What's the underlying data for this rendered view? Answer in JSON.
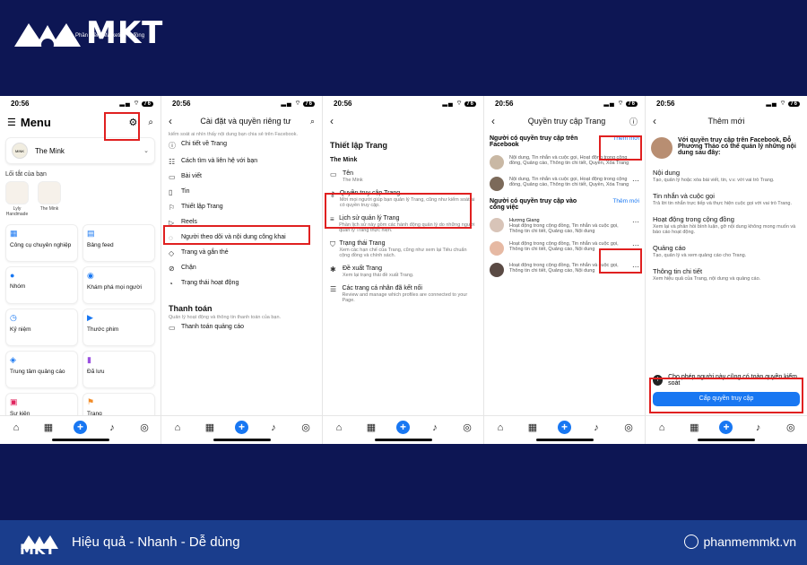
{
  "brand": {
    "name": "MKT",
    "sub": "Phần mềm Marketing 0 đồng"
  },
  "footer": {
    "tagline": "Hiệu quả - Nhanh  - Dễ dùng",
    "site": "phanmemmkt.vn"
  },
  "status_time": "20:56",
  "battery": "76",
  "phone1": {
    "title": "Menu",
    "profile": "The Mink",
    "shortcuts_label": "Lối tắt của bạn",
    "shortcuts": [
      "Lyly Handmade",
      "The Mink"
    ],
    "left": [
      "Công cụ chuyên nghiệp",
      "Nhóm",
      "Kỷ niệm",
      "Trung tâm quảng cáo",
      "Sự kiện"
    ],
    "right": [
      "Bảng feed",
      "Khám phá mọi người",
      "Thước phim",
      "Đã lưu",
      "Trang"
    ]
  },
  "phone2": {
    "title": "Cài đặt và quyền riêng tư",
    "note": "kiểm soát ai nhìn thấy nội dung bạn chia sẻ trên Facebook.",
    "items": [
      "Chi tiết về Trang",
      "Cách tìm và liên hệ với bạn",
      "Bài viết",
      "Tin",
      "Thiết lập Trang",
      "Reels",
      "Người theo dõi và nội dung công khai",
      "Trang và gắn thẻ",
      "Chặn",
      "Trạng thái hoạt động"
    ],
    "section": "Thanh toán",
    "section_note": "Quản lý hoạt động và thông tin thanh toán của bạn.",
    "section_item": "Thanh toán quảng cáo"
  },
  "phone3": {
    "title": "Thiết lập Trang",
    "page": "The Mink",
    "items": [
      {
        "t": "Tên",
        "d": "The Mink"
      },
      {
        "t": "Quyền truy cập Trang",
        "d": "Mời mọi người giúp bạn quản lý Trang, cũng như kiểm soát ai có quyền truy cập."
      },
      {
        "t": "Lịch sử quản lý Trang",
        "d": "Phần lịch sử này gồm các hành động quản lý do những người quản lý Trang thực hiện."
      },
      {
        "t": "Trạng thái Trang",
        "d": "Xem các hạn chế của Trang, cũng như xem lại Tiêu chuẩn cộng đồng và chính sách."
      },
      {
        "t": "Đề xuất Trang",
        "d": "Xem lại trạng thái đề xuất Trang."
      },
      {
        "t": "Các trang cá nhân đã kết nối",
        "d": "Review and manage which profiles are connected to your Page."
      }
    ]
  },
  "phone4": {
    "title": "Quyền truy cập Trang",
    "fb_section": "Người có quyền truy cập trên Facebook",
    "add": "Thêm mới",
    "fb_people": [
      "Nội dung, Tin nhắn và cuộc gọi, Hoạt động trong cộng đồng, Quảng cáo, Thông tin chi tiết, Quyền, Xóa Trang",
      "Nội dung, Tin nhắn và cuộc gọi, Hoạt động trong cộng đồng, Quảng cáo, Thông tin chi tiết, Quyền, Xóa Trang"
    ],
    "task_section": "Người có quyền truy cập vào công việc",
    "task_people": [
      "Hương Giang",
      "Hoạt động trong cộng đồng, Tin nhắn và cuộc gọi, Thông tin chi tiết, Quảng cáo, Nội dung",
      "Hoạt động trong cộng đồng, Tin nhắn và cuộc gọi, Thông tin chi tiết, Quảng cáo, Nội dung",
      "Hoạt động trong cộng đồng, Tin nhắn và cuộc gọi, Thông tin chi tiết, Quảng cáo, Nội dung"
    ]
  },
  "phone5": {
    "title": "Thêm mới",
    "intro": "Với quyền truy cập trên Facebook, Đỗ Phương Thảo có thể quản lý những nội dung sau đây:",
    "perms": [
      {
        "t": "Nội dung",
        "d": "Tạo, quản lý hoặc xóa bài viết, tin, v.v. với vai trò Trang."
      },
      {
        "t": "Tin nhắn và cuộc gọi",
        "d": "Trả lời tin nhắn trực tiếp và thực hiện cuộc gọi với vai trò Trang."
      },
      {
        "t": "Hoạt động trong cộng đồng",
        "d": "Xem lại và phản hồi bình luận, gỡ nội dung không mong muốn và báo cáo hoạt động."
      },
      {
        "t": "Quảng cáo",
        "d": "Tạo, quản lý và xem quảng cáo cho Trang."
      },
      {
        "t": "Thông tin chi tiết",
        "d": "Xem hiệu quả của Trang, nội dung và quảng cáo."
      }
    ],
    "full_control": "Cho phép người này cũng có toàn quyền kiểm soát",
    "grant": "Cấp quyền truy cập"
  }
}
